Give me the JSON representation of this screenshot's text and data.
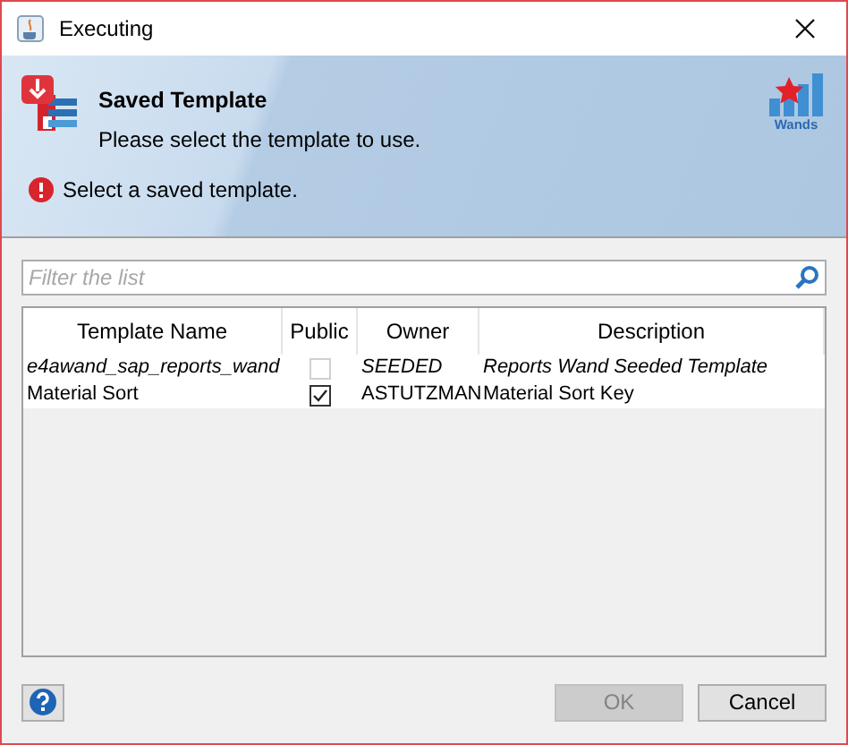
{
  "window": {
    "title": "Executing"
  },
  "header": {
    "title": "Saved Template",
    "subtitle": "Please select the template to use.",
    "logo_text": "Wands",
    "message": "Select a saved template."
  },
  "filter": {
    "placeholder": "Filter the list"
  },
  "table": {
    "columns": [
      "Template Name",
      "Public",
      "Owner",
      "Description"
    ],
    "rows": [
      {
        "kind": "seeded",
        "name": "e4awand_sap_reports_wand",
        "public": false,
        "disabled": true,
        "owner": "SEEDED",
        "description": "Reports Wand Seeded Template"
      },
      {
        "kind": "user",
        "name": "Material Sort",
        "public": true,
        "disabled": false,
        "owner": "ASTUTZMAN",
        "description": "Material Sort Key"
      }
    ]
  },
  "buttons": [
    {
      "label": "OK",
      "disabled": true
    },
    {
      "label": "Cancel",
      "disabled": false
    }
  ]
}
